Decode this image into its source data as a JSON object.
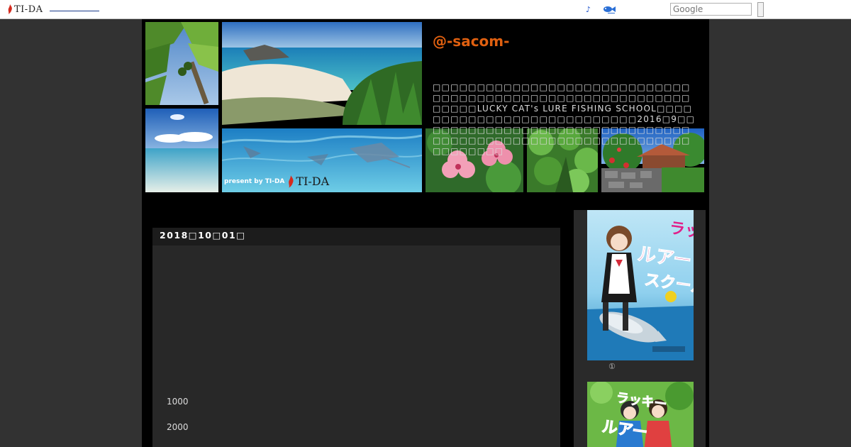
{
  "topbar": {
    "logo_text": "TI-DA",
    "music_icon": "♪",
    "search_placeholder": "Google",
    "icons": [
      "flame-icon",
      "music-note-icon",
      "fish-icon"
    ],
    "line_color": "#1a3a8a"
  },
  "header": {
    "title": "@-sacom-",
    "title_color": "#e06010",
    "description": "□□□□□□□□□□□□□□□□□□□□□□□□□□□□□\n□□□□□□□□□□□□□□□□□□□□□□□□□□□□□□□□□□LUCKY CAT's LURE FISHING SCHOOL□□□□□□□□□□□□□□□□□□□□□□□□□□□2016□9□□□□□□□□□□□□□□□□□□□□□□□□□□□□□□□□□□□□□□□□□□□□□□□□□□□□□□□□□□□□□□□□□□□□",
    "present_by": "present by TI-DA",
    "logo_text": "TI-DA"
  },
  "entry": {
    "date": "2018□10□01□",
    "lines": [
      "1000",
      "2000"
    ]
  },
  "sidebar": {
    "book1_caption": "①"
  }
}
